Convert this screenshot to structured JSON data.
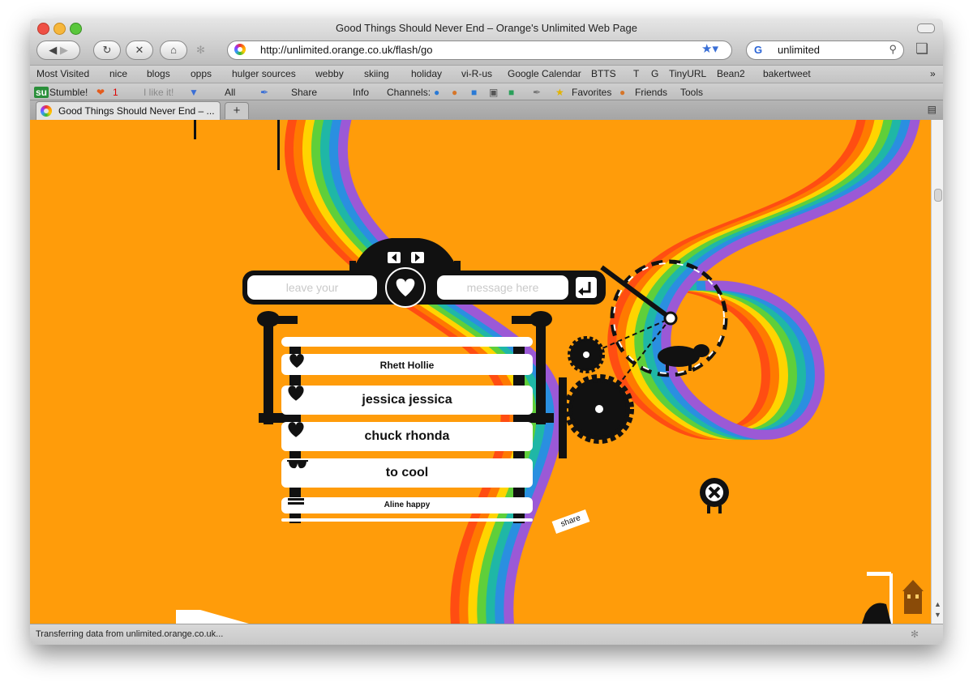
{
  "window": {
    "title": "Good Things Should Never End – Orange's Unlimited Web Page",
    "traffic_colors": [
      "#ef5045",
      "#f6b73c",
      "#5ac73c"
    ]
  },
  "toolbar": {
    "back_icon": "back-arrow-icon",
    "forward_icon": "forward-arrow-icon",
    "reload_icon": "reload-icon",
    "stop_icon": "stop-icon",
    "home_icon": "home-icon",
    "url": "http://unlimited.orange.co.uk/flash/go",
    "search_value": "unlimited"
  },
  "bookmarks": {
    "items": [
      "Most Visited",
      "nice",
      "blogs",
      "opps",
      "hulger sources",
      "webby",
      "skiing",
      "holiday",
      "vi-R-us",
      "Google Calendar",
      "BTTS",
      "T",
      "G",
      "TinyURL",
      "Bean2",
      "bakertweet"
    ]
  },
  "stumble_bar": {
    "stumble": "Stumble!",
    "like_count": "1",
    "like_label": "I like it!",
    "all": "All",
    "share": "Share",
    "info": "Info",
    "channels": "Channels:",
    "favorites": "Favorites",
    "friends": "Friends",
    "tools": "Tools"
  },
  "tab": {
    "label": "Good Things Should Never End – ...",
    "new_tab": "+"
  },
  "page": {
    "message_left_placeholder": "leave your",
    "message_right_placeholder": "message here",
    "messages": [
      {
        "left": "Rhett",
        "connector": "heart",
        "right": "Hollie"
      },
      {
        "left": "jessica",
        "connector": "heart",
        "right": "jessica"
      },
      {
        "left": "chuck",
        "connector": "heart",
        "right": "rhonda"
      },
      {
        "left": "to",
        "connector": "sunglasses",
        "right": "cool"
      },
      {
        "left": "Aline",
        "connector": "equals",
        "right": "happy"
      }
    ],
    "share_label": "share",
    "background_color": "#ff9900",
    "rainbow_colors": [
      "#ff4d12",
      "#ff7a00",
      "#ffd400",
      "#5fcf3a",
      "#1fb7a6",
      "#2a8fe0",
      "#9b59d6"
    ]
  },
  "status_bar": {
    "text": "Transferring data from unlimited.orange.co.uk..."
  }
}
